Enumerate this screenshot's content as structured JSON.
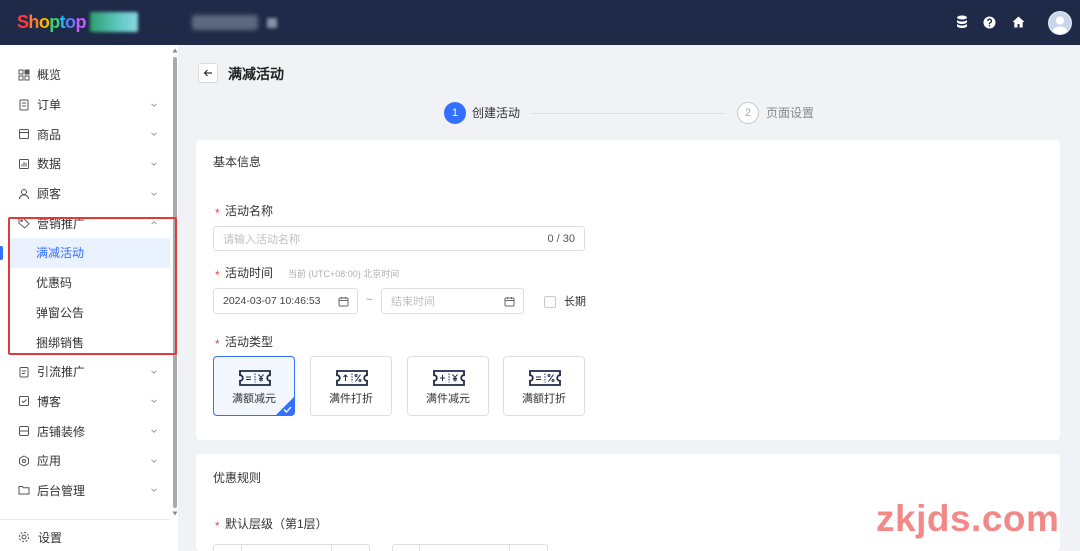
{
  "header": {
    "logo_letters": [
      "S",
      "h",
      "o",
      "p",
      "t",
      "o",
      "p"
    ],
    "logo_colors": [
      "#ff3b3b",
      "#ff7a2f",
      "#ffb400",
      "#3ecf6e",
      "#2bb5f0",
      "#5b7cff",
      "#c65bff"
    ],
    "right_icons": [
      "database-icon",
      "help-icon",
      "home-icon",
      "avatar"
    ]
  },
  "sidebar": {
    "items": [
      {
        "label": "概览",
        "icon": "dashboard-icon",
        "expandable": false
      },
      {
        "label": "订单",
        "icon": "order-icon",
        "expandable": true
      },
      {
        "label": "商品",
        "icon": "product-icon",
        "expandable": true
      },
      {
        "label": "数据",
        "icon": "analytics-icon",
        "expandable": true
      },
      {
        "label": "顾客",
        "icon": "customer-icon",
        "expandable": true
      },
      {
        "label": "营销推广",
        "icon": "tag-icon",
        "expandable": true,
        "expanded": true,
        "children": [
          {
            "label": "满减活动",
            "active": true
          },
          {
            "label": "优惠码",
            "active": false
          },
          {
            "label": "弹窗公告",
            "active": false
          },
          {
            "label": "捆绑销售",
            "active": false
          }
        ]
      },
      {
        "label": "引流推广",
        "icon": "traffic-icon",
        "expandable": true
      },
      {
        "label": "博客",
        "icon": "blog-icon",
        "expandable": true
      },
      {
        "label": "店铺装修",
        "icon": "store-design-icon",
        "expandable": true
      },
      {
        "label": "应用",
        "icon": "apps-icon",
        "expandable": true
      },
      {
        "label": "后台管理",
        "icon": "folder-icon",
        "expandable": true
      }
    ],
    "settings": {
      "label": "设置",
      "icon": "gear-icon"
    }
  },
  "page": {
    "title": "满减活动",
    "back_icon": "back-arrow-icon"
  },
  "steps": [
    {
      "number": "1",
      "label": "创建活动",
      "state": "active"
    },
    {
      "number": "2",
      "label": "页面设置",
      "state": "pending"
    }
  ],
  "required_mark": "*",
  "basic_info": {
    "title": "基本信息",
    "name_field": {
      "label": "活动名称",
      "required": true,
      "placeholder": "请输入活动名称",
      "value": "",
      "counter": "0 / 30"
    },
    "time_field": {
      "label": "活动时间",
      "required": true,
      "hint": "当前 (UTC+08:00) 北京时间",
      "start_value": "2024-03-07 10:46:53",
      "separator": "~",
      "end_placeholder": "结束时间",
      "long_term_label": "长期",
      "long_term_checked": false
    },
    "type_field": {
      "label": "活动类型",
      "required": true,
      "options": [
        {
          "label": "满额减元",
          "icon": "ticket-yuan-icon",
          "selected": true
        },
        {
          "label": "满件打折",
          "icon": "ticket-percent-icon",
          "selected": false
        },
        {
          "label": "满件减元",
          "icon": "ticket-yuan-icon",
          "selected": false
        },
        {
          "label": "满额打折",
          "icon": "ticket-percent-icon",
          "selected": false
        }
      ]
    }
  },
  "discount_rules": {
    "title": "优惠规则",
    "tier_label": "默认层级（第1层）",
    "tier_required": true
  },
  "watermark": "zkjds.com",
  "colors": {
    "header_bg": "#1e2a47",
    "primary": "#3370ff",
    "required": "#e34d4d",
    "highlight_box": "#e03a3a",
    "page_bg": "#f0f2f5"
  }
}
